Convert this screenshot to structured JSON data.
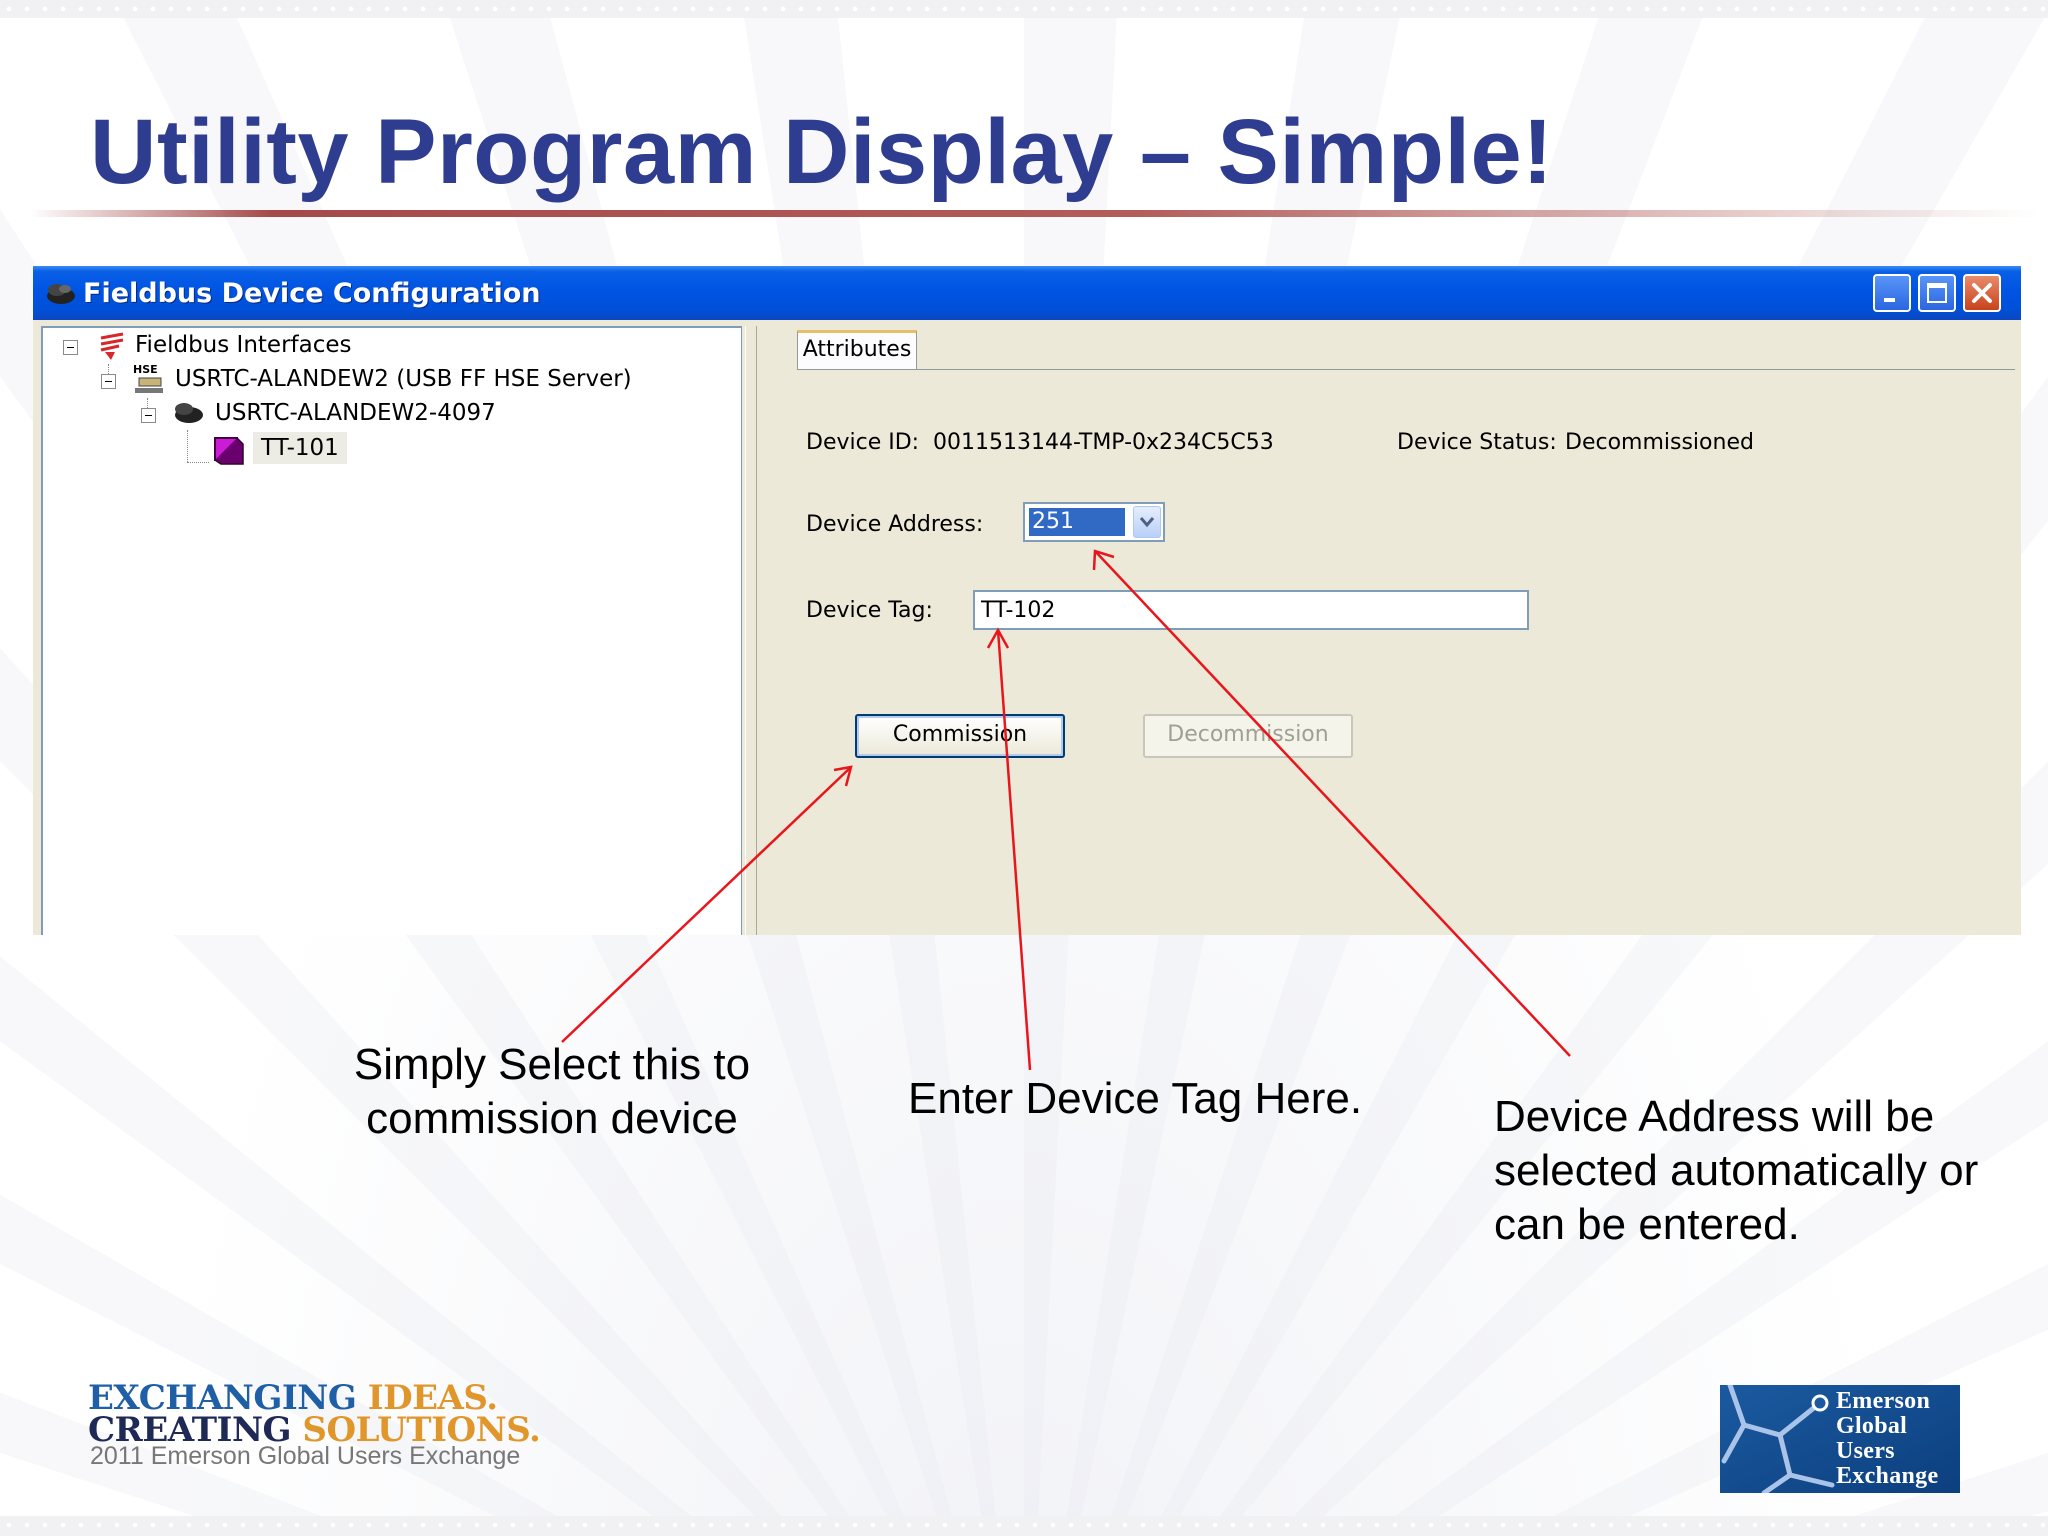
{
  "slide": {
    "title": "Utility Program Display – Simple!"
  },
  "window": {
    "title": "Fieldbus Device Configuration",
    "title_icon": "fieldbus-device-icon"
  },
  "tree": {
    "root": {
      "label": "Fieldbus Interfaces",
      "icon": "fieldbus-interfaces-icon"
    },
    "server": {
      "label": "USRTC-ALANDEW2 (USB FF HSE Server)",
      "icon": "hse-server-icon",
      "badge": "HSE"
    },
    "port": {
      "label": "USRTC-ALANDEW2-4097",
      "icon": "fieldbus-port-icon"
    },
    "device": {
      "label": "TT-101",
      "icon": "device-cube-icon"
    }
  },
  "panel": {
    "tab_label": "Attributes",
    "device_id_label": "Device ID:",
    "device_id_value": "0011513144-TMP-0x234C5C53",
    "device_status_label": "Device Status:",
    "device_status_value": "Decommissioned",
    "device_address_label": "Device Address:",
    "device_address_value": "251",
    "device_tag_label": "Device Tag:",
    "device_tag_value": "TT-102",
    "commission_label": "Commission",
    "decommission_label": "Decommission"
  },
  "annotations": {
    "commission_line1": "Simply Select this to",
    "commission_line2": "commission device",
    "tag": "Enter Device Tag Here.",
    "address_line1": "Device Address will be",
    "address_line2": "selected automatically or",
    "address_line3": "can be entered."
  },
  "footer": {
    "left_line1_a": "EXCHANGING ",
    "left_line1_b": "IDEAS.",
    "left_line2_a": "CREATING ",
    "left_line2_b": "SOLUTIONS.",
    "left_sub": "2011 Emerson Global Users Exchange",
    "right_line1": "Emerson",
    "right_line2": "Global",
    "right_line3": "Users",
    "right_line4": "Exchange"
  },
  "colors": {
    "title": "#2e3d8f",
    "titlebar": "#0054e3",
    "arrow": "#e8161c",
    "selection": "#316ac5"
  }
}
